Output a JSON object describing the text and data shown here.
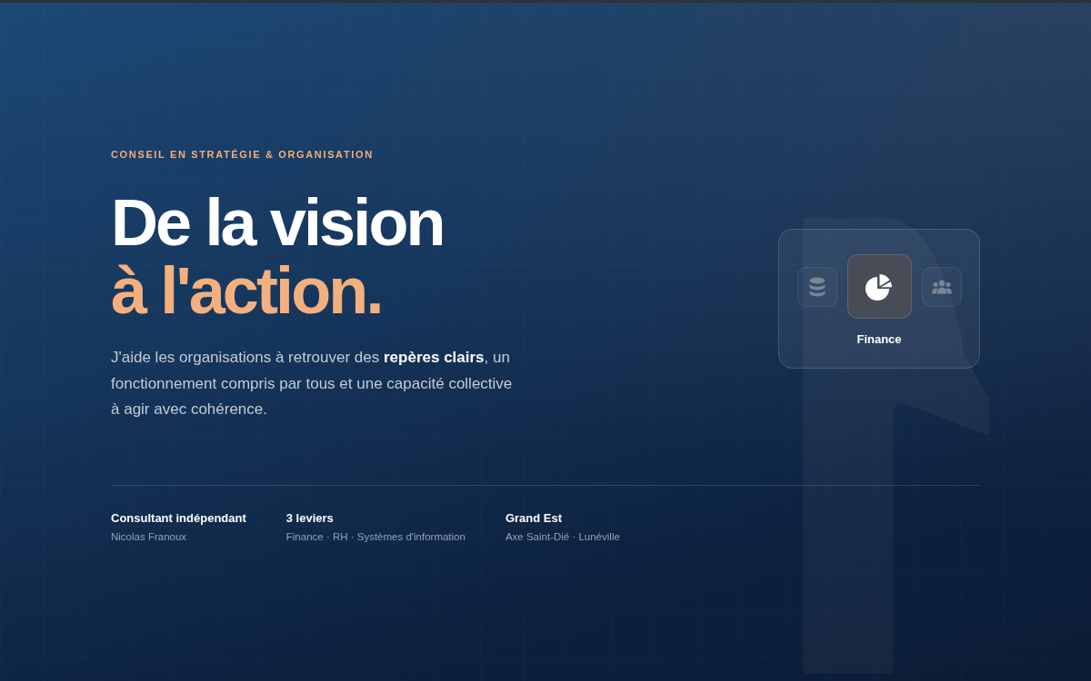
{
  "hero": {
    "eyebrow": "CONSEIL EN STRATÉGIE & ORGANISATION",
    "title_line_1": "De la vision",
    "title_line_2": "à l'action.",
    "intro": "J'aide les organisations à retrouver des **repères clairs**, un fonctionnement compris par tous et une capacité collective à agir avec cohérence."
  },
  "facts": [
    {
      "title": "Consultant indépendant",
      "detail": "Nicolas Franoux"
    },
    {
      "title": "3 leviers",
      "detail": "Finance · RH · Systèmes d'information"
    },
    {
      "title": "Grand Est",
      "detail": "Axe Saint-Dié · Lunéville"
    }
  ],
  "levers_card": {
    "items": [
      {
        "kind": "database",
        "selected": false
      },
      {
        "kind": "pie",
        "selected": true
      },
      {
        "kind": "people",
        "selected": false
      }
    ],
    "label": "Finance"
  }
}
